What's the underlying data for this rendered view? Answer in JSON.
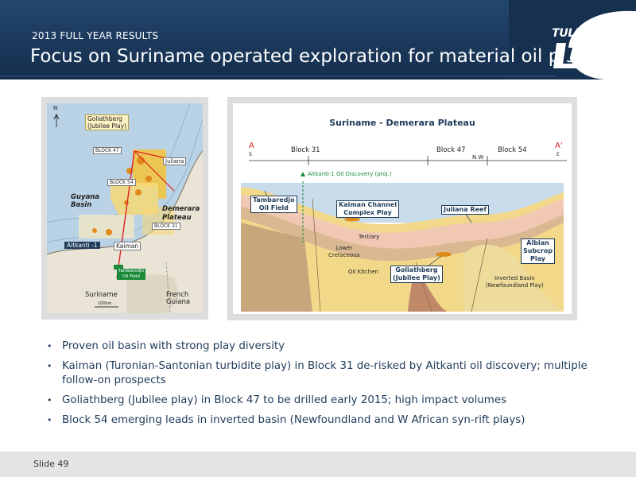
{
  "header": {
    "kicker": "2013 FULL YEAR RESULTS",
    "title": "Focus on Suriname operated exploration for material oil plays",
    "logo_text": "TULLOW",
    "logo_sub": "plc",
    "colors": {
      "banner": "#1d3c60",
      "banner_dark": "#16304f"
    }
  },
  "map": {
    "north": "N",
    "labels": {
      "goliathberg": "Goliathberg\n(Jubilee Play)",
      "block47": "BLOCK 47",
      "block54": "BLOCK 54",
      "block31": "BLOCK 31",
      "juliana": "Juliana",
      "guyana_basin": "Guyana\nBasin",
      "demerara_plateau": "Demerara\nPlateau",
      "aitkanti": "Aitkanti -1",
      "kaiman": "Kaiman",
      "tambaredjo": "Tambaredjo\nOil Field",
      "suriname": "Suriname",
      "french_guiana": "French\nGuiana",
      "scale": "100km"
    }
  },
  "section": {
    "title": "Suriname - Demerara Plateau",
    "a_left": "A",
    "s_left": "S",
    "a_right": "A'",
    "e_right": "E",
    "block31": "Block 31",
    "block47": "Block 47",
    "block54": "Block 54",
    "nw": "N W",
    "discovery": "Aitkanti-1 Oil Discovery (proj.)",
    "tambaredjo": "Tambaredjo\nOil Field",
    "kaiman": "Kaiman Channel\nComplex Play",
    "juliana_reef": "Juliana Reef",
    "tertiary": "Tertiary",
    "lower_cretaceous": "Lower\nCretaceous",
    "oil_kitchen": "Oil Kitchen",
    "goliathberg": "Goliathberg\n(Jubilee Play)",
    "albian": "Albian\nSubcrop\nPlay",
    "inverted_basin": "Inverted Basin\n(Newfoundland Play)"
  },
  "bullets": [
    "Proven oil basin with strong play diversity",
    "Kaiman (Turonian-Santonian turbidite play) in Block 31 de-risked by Aitkanti oil discovery; multiple follow-on prospects",
    "Goliathberg (Jubilee play) in Block 47 to be drilled early 2015; high impact volumes",
    "Block 54 emerging leads in inverted basin (Newfoundland  and W African syn-rift plays)"
  ],
  "footer": {
    "slide_label": "Slide 49"
  }
}
